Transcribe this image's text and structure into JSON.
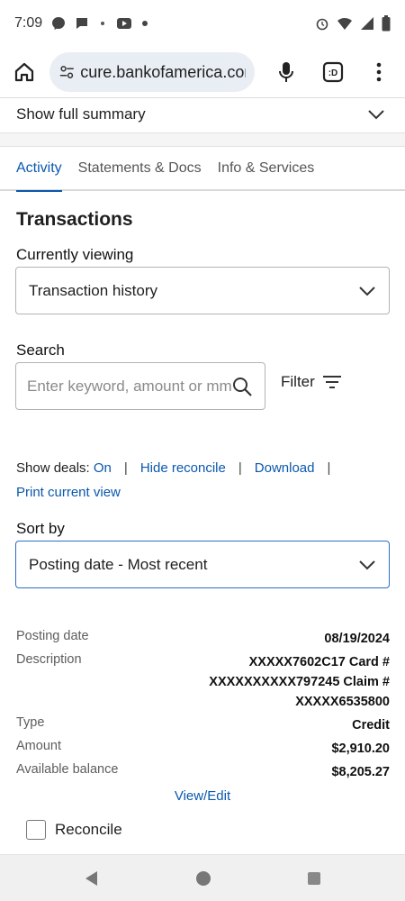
{
  "status_bar": {
    "time": "7:09"
  },
  "browser": {
    "url": "cure.bankofamerica.com"
  },
  "summary": {
    "label": "Show full summary"
  },
  "tabs": [
    {
      "label": "Activity",
      "active": true
    },
    {
      "label": "Statements & Docs",
      "active": false
    },
    {
      "label": "Info & Services",
      "active": false
    }
  ],
  "transactions": {
    "heading": "Transactions",
    "viewing_label": "Currently viewing",
    "viewing_value": "Transaction history",
    "search_label": "Search",
    "search_placeholder": "Enter keyword, amount or mm",
    "filter_label": "Filter"
  },
  "links": {
    "show_deals_label": "Show deals:",
    "show_deals_value": "On",
    "hide_reconcile": "Hide reconcile",
    "download": "Download",
    "print": "Print current view",
    "separator": "|"
  },
  "sort": {
    "label": "Sort by",
    "value": "Posting date - Most recent"
  },
  "transaction": {
    "posting_date_label": "Posting date",
    "posting_date": "08/19/2024",
    "description_label": "Description",
    "description_lines": [
      "XXXXX7602C17 Card #",
      "XXXXXXXXXX797245 Claim #",
      "XXXXX6535800"
    ],
    "type_label": "Type",
    "type": "Credit",
    "amount_label": "Amount",
    "amount": "$2,910.20",
    "balance_label": "Available balance",
    "balance": "$8,205.27",
    "view_edit": "View/Edit",
    "reconcile_label": "Reconcile"
  },
  "colors": {
    "link": "#0a58ad",
    "active_tab": "#0a58ad",
    "select_focus_border": "#2a6fc9"
  },
  "icons": [
    "messenger-icon",
    "chat-icon",
    "dots-icon",
    "youtube-icon",
    "alarm-icon",
    "wifi-icon",
    "signal-icon",
    "battery-icon",
    "home-icon",
    "site-settings-icon",
    "mic-icon",
    "tab-switcher-icon",
    "overflow-menu-icon",
    "chevron-down-icon",
    "search-icon",
    "filter-icon",
    "back-icon",
    "home-nav-icon",
    "recents-icon"
  ]
}
